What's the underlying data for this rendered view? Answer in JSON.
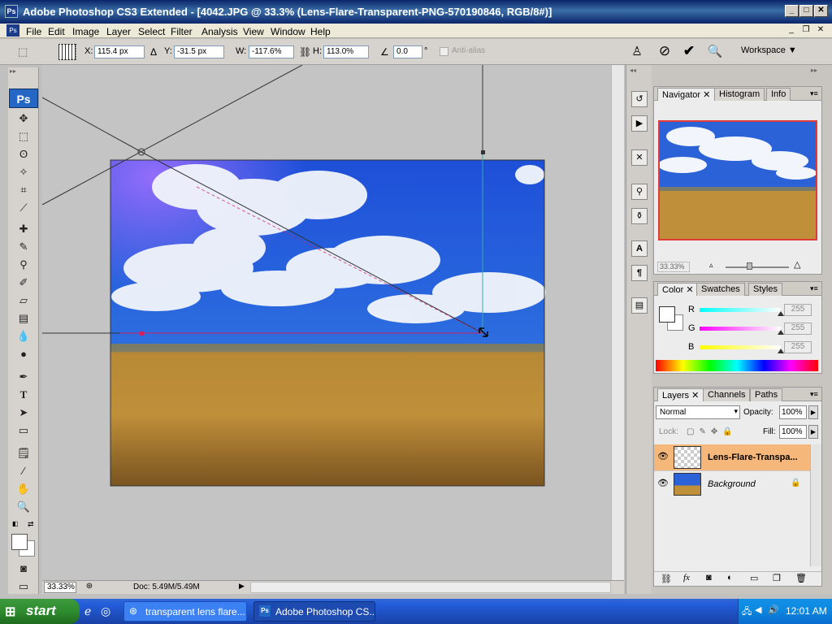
{
  "title_bar": {
    "app_icon": "Ps",
    "title": "Adobe Photoshop CS3 Extended - [4042.JPG @ 33.3% (Lens-Flare-Transparent-PNG-570190846, RGB/8#)]",
    "minimize": "_",
    "maximize": "□",
    "close": "✕"
  },
  "menu": {
    "items": [
      "File",
      "Edit",
      "Image",
      "Layer",
      "Select",
      "Filter",
      "Analysis",
      "View",
      "Window",
      "Help"
    ]
  },
  "options": {
    "x_label": "X:",
    "x_value": "115.4 px",
    "y_label": "Y:",
    "y_value": "-31.5 px",
    "w_label": "W:",
    "w_value": "-117.6%",
    "h_label": "H:",
    "h_value": "113.0%",
    "angle_value": "0.0",
    "angle_unit": "°",
    "antialias_label": "Anti-alias",
    "workspace_label": "Workspace ▼"
  },
  "status": {
    "zoom": "33.33%",
    "doc": "Doc: 5.49M/5.49M"
  },
  "toolbox": {
    "logo": "Ps"
  },
  "navigator": {
    "tabs": [
      "Navigator",
      "Histogram",
      "Info"
    ],
    "zoom": "33.33%"
  },
  "color": {
    "tabs": [
      "Color",
      "Swatches",
      "Styles"
    ],
    "r_label": "R",
    "r_value": "255",
    "g_label": "G",
    "g_value": "255",
    "b_label": "B",
    "b_value": "255"
  },
  "layers": {
    "tabs": [
      "Layers",
      "Channels",
      "Paths"
    ],
    "blend_mode": "Normal",
    "opacity_label": "Opacity:",
    "opacity_value": "100%",
    "lock_label": "Lock:",
    "fill_label": "Fill:",
    "fill_value": "100%",
    "rows": [
      {
        "name": "Lens-Flare-Transpa...",
        "selected": true
      },
      {
        "name": "Background",
        "selected": false
      }
    ]
  },
  "taskbar": {
    "start": "start",
    "items": [
      "transparent lens flare...",
      "Adobe Photoshop CS..."
    ],
    "time": "12:01 AM"
  },
  "colors": {
    "accent": "#0a246a",
    "selected_layer": "#f5b77a"
  }
}
